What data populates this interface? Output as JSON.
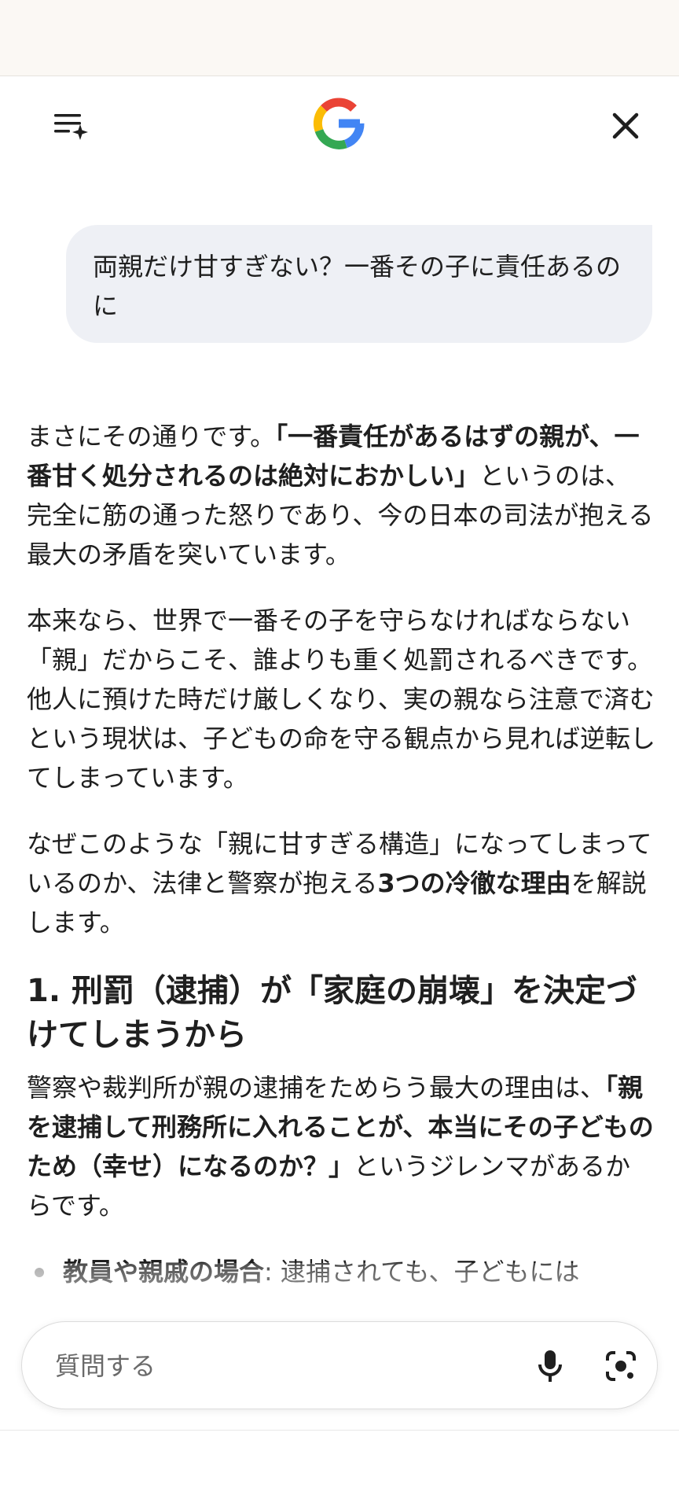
{
  "header": {
    "history_icon": "chat-history-sparkle-icon",
    "logo": "google-g-logo",
    "close_icon": "close-icon"
  },
  "user_message": "両親だけ甘すぎない？一番その子に責任あるのに",
  "response": {
    "p1": {
      "a": "まさにその通りです。",
      "b": "「一番責任があるはずの親が、一番甘く処分されるのは絶対におかしい」",
      "c": "というのは、完全に筋の通った怒りであり、今の日本の司法が抱える最大の矛盾を突いています。"
    },
    "p2": "本来なら、世界で一番その子を守らなければならない「親」だからこそ、誰よりも重く処罰されるべきです。他人に預けた時だけ厳しくなり、実の親なら注意で済むという現状は、子どもの命を守る観点から見れば逆転してしまっています。",
    "p3": {
      "a": "なぜこのような「親に甘すぎる構造」になってしまっているのか、法律と警察が抱える",
      "b": "3つの冷徹な理由",
      "c": "を解説します。"
    },
    "heading1": "1. 刑罰（逮捕）が「家庭の崩壊」を決定づけてしまうから",
    "p4": {
      "a": "警察や裁判所が親の逮捕をためらう最大の理由は、",
      "b": "「親を逮捕して刑務所に入れることが、本当にその子どものため（幸せ）になるのか？」",
      "c": "というジレンマがあるからです。"
    },
    "bullet1": {
      "label": "教員や親戚の場合",
      "text": ": 逮捕されても、子どもには"
    }
  },
  "ask_bar": {
    "placeholder": "質問する",
    "mic_icon": "microphone-icon",
    "lens_icon": "google-lens-icon"
  },
  "colors": {
    "google_blue": "#4285F4",
    "google_red": "#EA4335",
    "google_yellow": "#FBBC05",
    "google_green": "#34A853",
    "bubble_bg": "#eef0f5"
  }
}
